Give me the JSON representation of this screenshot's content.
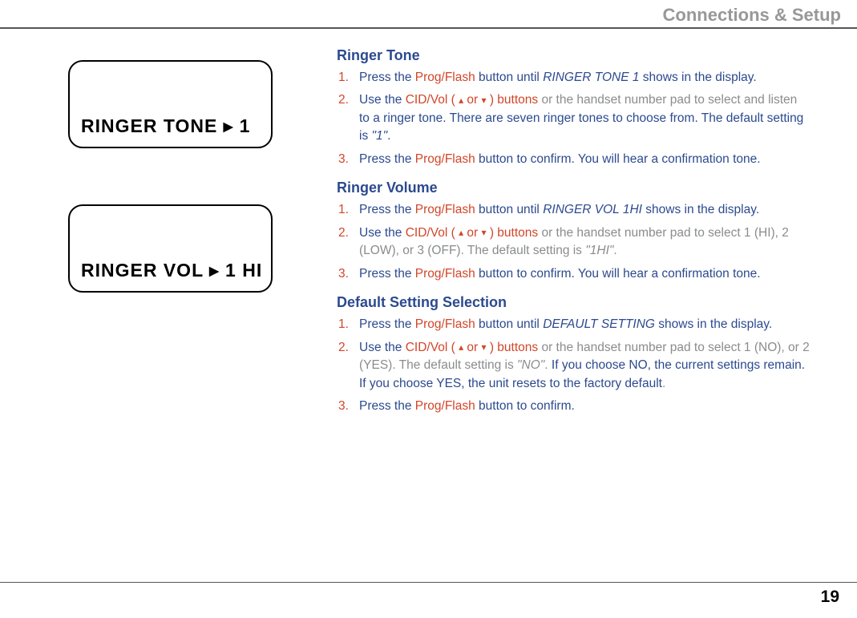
{
  "header_title": "Connections & Setup",
  "page_number": "19",
  "lcd": {
    "screen1": "RINGER  TONE   ▸ 1",
    "screen2": "RINGER  VOL    ▸ 1 HI"
  },
  "sections": {
    "ringer_tone": {
      "heading": "Ringer Tone",
      "steps": {
        "1": {
          "num": "1.",
          "t1": "Press the ",
          "progflash": "Prog/Flash",
          "t2": " button until ",
          "italic": "RINGER TONE 1",
          "t3": " shows in the display."
        },
        "2": {
          "num": "2.",
          "t1": "Use the ",
          "cidvol_pre": "CID/Vol ( ",
          "cidvol_mid": " or ",
          "cidvol_post": " ) buttons",
          "gray1": " or the handset number pad to select and listen",
          "t2": " to a ringer tone. There are seven ringer tones to choose from. The default setting is ",
          "italic": "\"1\"",
          "t3": "."
        },
        "3": {
          "num": "3.",
          "t1": "Press the ",
          "progflash": "Prog/Flash",
          "t2": " button to confirm. You will hear a confirmation tone."
        }
      }
    },
    "ringer_volume": {
      "heading": "Ringer Volume",
      "steps": {
        "1": {
          "num": "1.",
          "t1": "Press the ",
          "progflash": "Prog/Flash",
          "t2": " button until ",
          "italic": "RINGER VOL 1HI",
          "t3": " shows in the display."
        },
        "2": {
          "num": "2.",
          "t1": "Use the ",
          "cidvol_pre": "CID/Vol ( ",
          "cidvol_mid": " or ",
          "cidvol_post": " ) buttons",
          "gray1": " or the handset number pad to select 1 (HI), 2 (LOW), or 3 (OFF). The default setting is ",
          "italic": "\"1HI\"",
          "t3": "."
        },
        "3": {
          "num": "3.",
          "t1": "Press the ",
          "progflash": "Prog/Flash",
          "t2": " button to confirm. You will hear a confirmation tone."
        }
      }
    },
    "default_setting": {
      "heading": "Default Setting Selection",
      "steps": {
        "1": {
          "num": "1.",
          "t1": "Press the ",
          "progflash": "Prog/Flash",
          "t2": " button until ",
          "italic": "DEFAULT SETTING",
          "t3": " shows in the display."
        },
        "2": {
          "num": "2.",
          "t1": "Use the ",
          "cidvol_pre": "CID/Vol ( ",
          "cidvol_mid": " or ",
          "cidvol_post": " ) buttons",
          "gray1": " or the handset number pad to select 1 (NO), or 2 (YES). The default setting is ",
          "italic": "\"NO\"",
          "gray2": ".",
          "t2": " If you choose NO, the current settings remain. If you choose YES, the unit resets to the factory default",
          "t3": "."
        },
        "3": {
          "num": "3.",
          "t1": "Press the ",
          "progflash": "Prog/Flash",
          "t2": " button to confirm."
        }
      }
    }
  }
}
